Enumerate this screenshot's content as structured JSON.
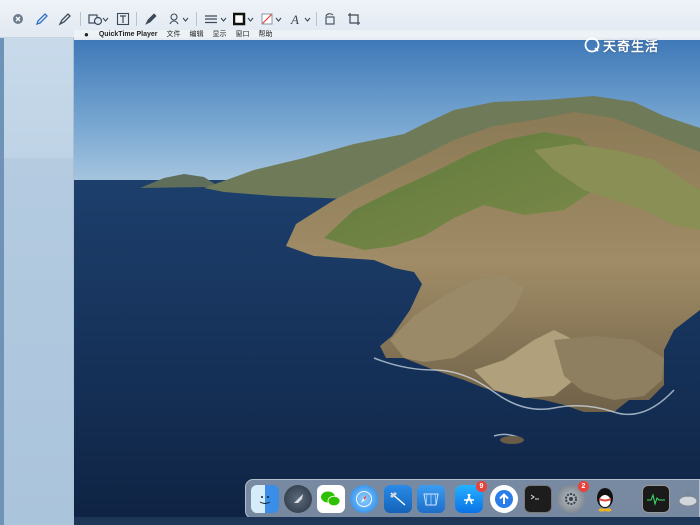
{
  "menubar": {
    "app_name": "QuickTime Player",
    "items": [
      "文件",
      "编辑",
      "显示",
      "窗口",
      "帮助"
    ]
  },
  "watermark": {
    "text": "天奇生活"
  },
  "toolbar": {
    "tools": [
      "close",
      "pen",
      "highlighter",
      "shapes",
      "text",
      "sign",
      "annotate",
      "line-style",
      "border-color",
      "fill-color",
      "text-style",
      "rotate",
      "crop"
    ]
  },
  "dock": {
    "apps": [
      {
        "name": "finder",
        "badge": ""
      },
      {
        "name": "launchpad",
        "badge": ""
      },
      {
        "name": "wechat",
        "badge": ""
      },
      {
        "name": "safari",
        "badge": ""
      },
      {
        "name": "xcode",
        "badge": ""
      },
      {
        "name": "simulator",
        "badge": ""
      },
      {
        "name": "app-store",
        "badge": "9"
      },
      {
        "name": "transloader",
        "badge": ""
      },
      {
        "name": "terminal",
        "badge": ""
      },
      {
        "name": "system-preferences",
        "badge": "2"
      },
      {
        "name": "qq",
        "badge": ""
      },
      {
        "name": "activity-monitor",
        "badge": ""
      },
      {
        "name": "disk-utility",
        "badge": ""
      }
    ]
  },
  "colors": {
    "toolbar_bg": "#e6edf4",
    "sky": "#4f86bf",
    "sea": "#142e55",
    "badge": "#e8423a"
  }
}
